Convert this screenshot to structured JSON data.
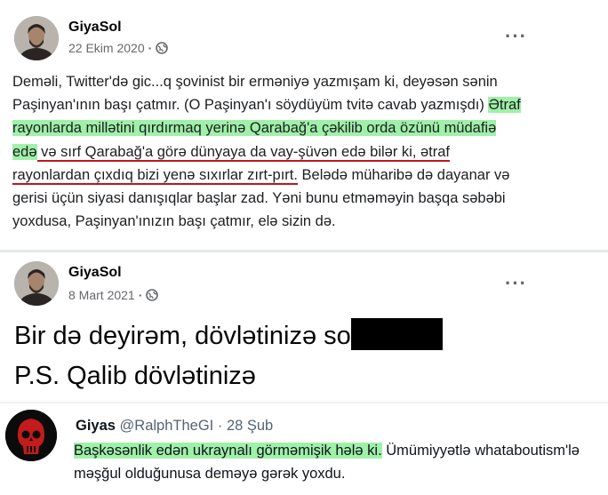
{
  "post1": {
    "author": "GiyaSol",
    "date": "22 Ekim 2020",
    "text_plain1": "Deməli, Twitter'də gic...q şovinist bir erməniyə yazmışam ki, deyəsən sənin Paşinyan'ının başı çatmır. (O Paşinyan'ı söydüyüm tvitə cavab yazmışdı) ",
    "text_hl1": "Ətraf rayonlarda millətini qırdırmaq yerinə Qarabağ'a çəkilib orda özünü müdafiə edə",
    "text_ul": " və sırf Qarabağ'a görə dünyaya da vay-şüvən edə bilər ki, ətraf rayonlardan çıxdıq bizi yenə sıxırlar zırt-pırt.",
    "text_plain2": " Belədə müharibə də dayanar və gerisi üçün siyasi danışıqlar başlar zad. Yəni bunu etməməyin başqa səbəbi yoxdusa, Paşinyan'ınızın başı çatmır, elə sizin də.",
    "more_icon": "three-dots-icon",
    "privacy_icon": "globe-icon"
  },
  "post2": {
    "author": "GiyaSol",
    "date": "8 Mart 2021",
    "line1": "Bir də deyirəm, dövlətinizə so",
    "line2": "P.S. Qalib dövlətinizə"
  },
  "tweet": {
    "name": "Giyas",
    "handle": "@RalphTheGI",
    "time": "· 28 Şub",
    "text_hl": "Başkəsənlik edən ukraynalı görməmişik hələ ki.",
    "text_rest": " Ümümiyyətlə whataboutism'lə məşğul olduğunusa deməyə gərək yoxdu."
  },
  "colors": {
    "highlight": "#9ff0a8",
    "underline": "#c0151b",
    "secondary_text": "#65676b"
  }
}
